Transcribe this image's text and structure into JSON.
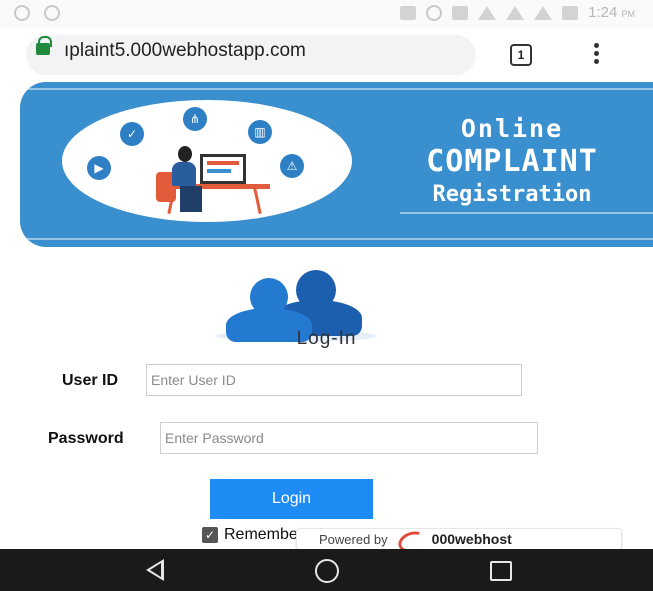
{
  "status_bar": {
    "time": "1:24",
    "period": "PM",
    "icons": [
      "app-notification-icon",
      "app-notification-icon",
      "cast-icon",
      "dnd-icon",
      "vibrate-icon",
      "wifi-icon",
      "signal-icon",
      "signal-icon",
      "battery-icon"
    ]
  },
  "browser": {
    "url": "ıplaint5.000webhostapp.com",
    "tab_count": "1",
    "lock_icon": "lock-icon",
    "menu_icon": "more-vert-icon"
  },
  "banner": {
    "line1": "Online",
    "line2": "COMPLAINT",
    "line3": "Registration",
    "accent_color": "#3a8fce"
  },
  "login": {
    "heading": "Log-In",
    "user_label": "User ID",
    "user_placeholder": "Enter User ID",
    "password_label": "Password",
    "password_placeholder": "Enter Password",
    "button_label": "Login",
    "remember_label": "Remember me",
    "remember_checked": true,
    "button_color": "#1f8cf5"
  },
  "footer_badge": {
    "prefix": "Powered by",
    "brand": "000webhost"
  },
  "nav_bar": {
    "icons": [
      "back-icon",
      "home-icon",
      "recent-apps-icon"
    ]
  }
}
